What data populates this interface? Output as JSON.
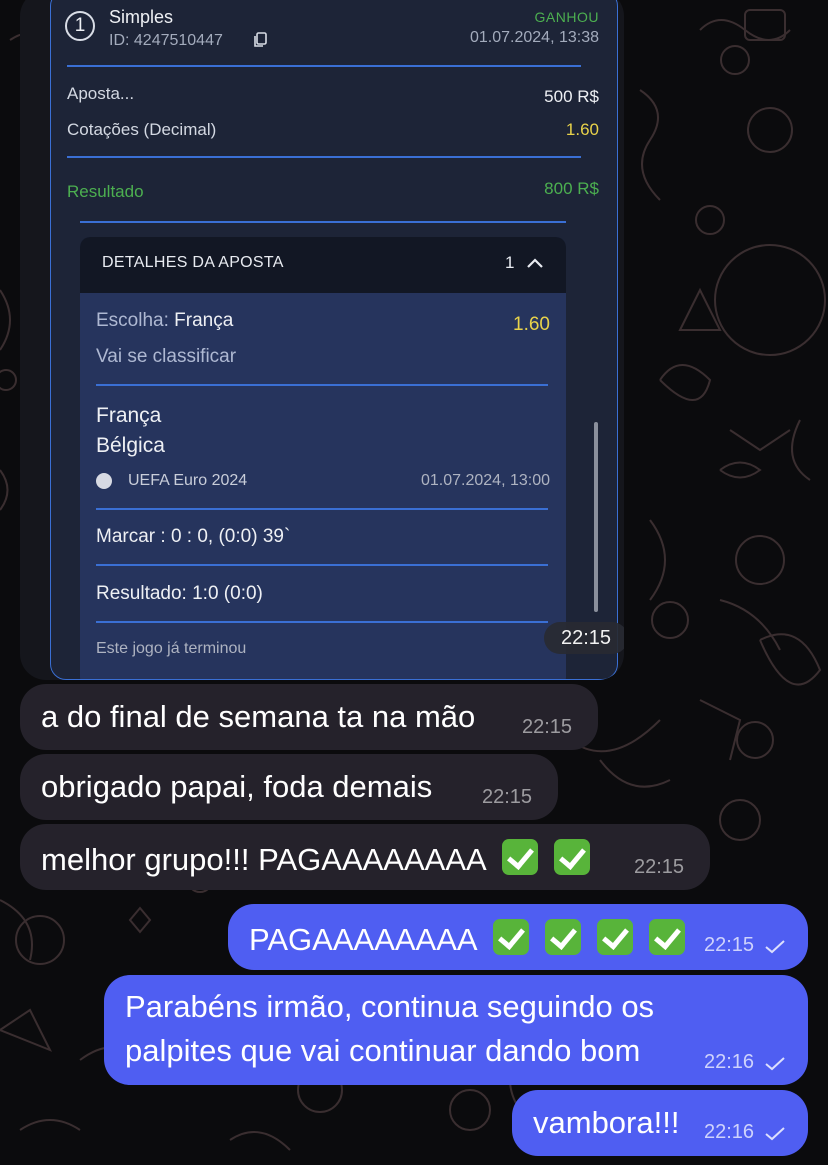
{
  "bet_screenshot": {
    "bet_number": "1",
    "bet_type": "Simples",
    "bet_id": "ID: 4247510447",
    "status": "GANHOU",
    "datetime": "01.07.2024, 13:38",
    "stake_label": "Aposta...",
    "stake_value": "500 R$",
    "odds_label": "Cotações (Decimal)",
    "odds_value": "1.60",
    "result_label": "Resultado",
    "result_value": "800 R$",
    "details": {
      "title": "DETALHES DA APOSTA",
      "count": "1",
      "choice_label": "Escolha:",
      "choice_value": "França",
      "choice_odds": "1.60",
      "market": "Vai se classificar",
      "team_home": "França",
      "team_away": "Bélgica",
      "competition": "UEFA Euro 2024",
      "match_datetime": "01.07.2024, 13:00",
      "score_line": "Marcar : 0 : 0, (0:0) 39`",
      "result_line": "Resultado: 1:0 (0:0)",
      "footer": "Este jogo já terminou"
    },
    "time": "22:15"
  },
  "messages": [
    {
      "direction": "incoming",
      "text": "a do final de semana ta na mão",
      "time": "22:15"
    },
    {
      "direction": "incoming",
      "text": "obrigado papai, foda demais",
      "time": "22:15"
    },
    {
      "direction": "incoming",
      "text": "melhor grupo!!! PAGAAAAAAAA",
      "emoji": [
        "check-mark-button",
        "check-mark-button"
      ],
      "time": "22:15"
    },
    {
      "direction": "outgoing",
      "text": "PAGAAAAAAAA",
      "emoji": [
        "check-mark-button",
        "check-mark-button",
        "check-mark-button",
        "check-mark-button"
      ],
      "time": "22:15",
      "read_status": "sent"
    },
    {
      "direction": "outgoing",
      "lines": [
        "Parabéns irmão, continua seguindo os",
        "palpites que vai continuar dando bom"
      ],
      "time": "22:16",
      "read_status": "sent"
    },
    {
      "direction": "outgoing",
      "text": "vambora!!!",
      "time": "22:16",
      "read_status": "sent"
    }
  ],
  "colors": {
    "background": "#0b0b0d",
    "incoming_bubble": "#25222b",
    "outgoing_bubble": "#4f5ef2",
    "card": "#1d2437",
    "card_border": "#3a6fd4",
    "win_green": "#4caf50",
    "odds_yellow": "#e8d24a"
  }
}
